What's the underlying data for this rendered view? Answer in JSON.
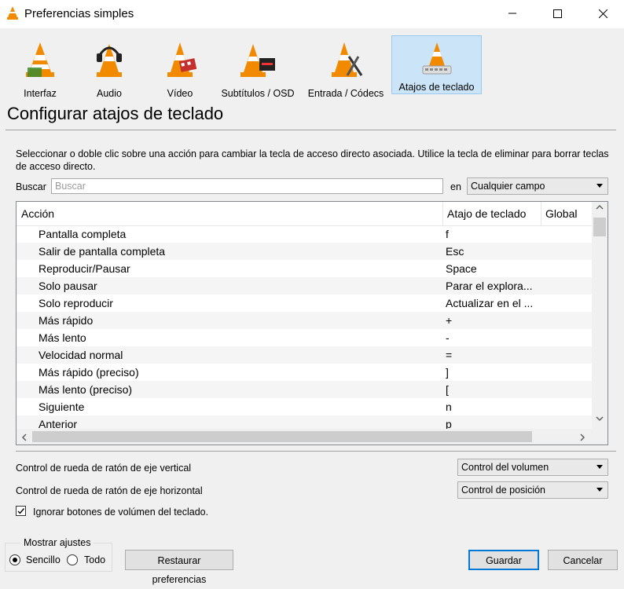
{
  "window": {
    "title": "Preferencias simples"
  },
  "categories": [
    {
      "label": "Interfaz",
      "selected": false
    },
    {
      "label": "Audio",
      "selected": false
    },
    {
      "label": "Vídeo",
      "selected": false
    },
    {
      "label": "Subtítulos / OSD",
      "selected": false
    },
    {
      "label": "Entrada / Códecs",
      "selected": false
    },
    {
      "label": "Atajos de teclado",
      "selected": true
    }
  ],
  "section": {
    "title": "Configurar atajos de teclado",
    "description": "Seleccionar o doble clic sobre una acción para cambiar la tecla de acceso directo asociada. Utilice la tecla de eliminar para borrar teclas de acceso directo."
  },
  "search": {
    "label": "Buscar",
    "placeholder": "Buscar",
    "in_label": "en",
    "field_value": "Cualquier campo"
  },
  "table": {
    "columns": [
      "Acción",
      "Atajo de teclado",
      "Global"
    ],
    "rows": [
      {
        "action": "Pantalla completa",
        "key": "f"
      },
      {
        "action": "Salir de pantalla completa",
        "key": "Esc"
      },
      {
        "action": "Reproducir/Pausar",
        "key": "Space"
      },
      {
        "action": "Solo pausar",
        "key": "Parar el explora..."
      },
      {
        "action": "Solo reproducir",
        "key": "Actualizar en el ..."
      },
      {
        "action": "Más rápido",
        "key": "+"
      },
      {
        "action": "Más lento",
        "key": "-"
      },
      {
        "action": "Velocidad normal",
        "key": "="
      },
      {
        "action": "Más rápido (preciso)",
        "key": "]"
      },
      {
        "action": "Más lento (preciso)",
        "key": "["
      },
      {
        "action": "Siguiente",
        "key": "n"
      },
      {
        "action": "Anterior",
        "key": "p"
      }
    ]
  },
  "wheel": {
    "vertical_label": "Control de rueda de ratón de eje vertical",
    "vertical_value": "Control del volumen",
    "horizontal_label": "Control de rueda de ratón de eje horizontal",
    "horizontal_value": "Control de posición"
  },
  "ignore_volume": {
    "label": "Ignorar botones de volúmen del teclado.",
    "checked": true
  },
  "show_settings": {
    "title": "Mostrar ajustes",
    "simple": "Sencillo",
    "all": "Todo"
  },
  "buttons": {
    "restore": "Restaurar preferencias",
    "save": "Guardar",
    "cancel": "Cancelar"
  },
  "colors": {
    "accent": "#0078d7",
    "selected_bg": "#cce4f7",
    "vlc_orange": "#f28a00"
  }
}
